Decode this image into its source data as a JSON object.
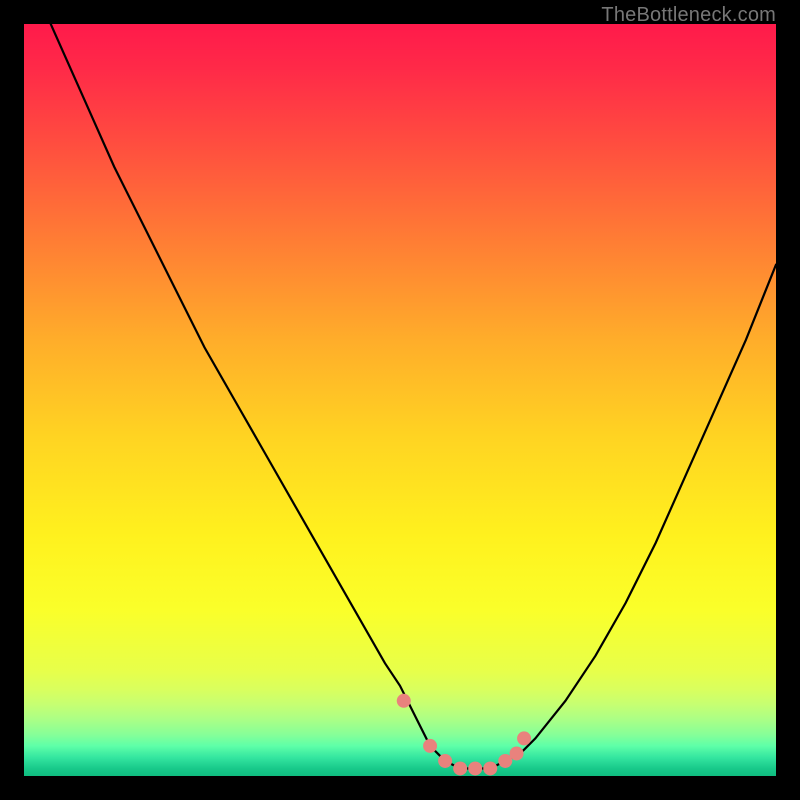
{
  "watermark": "TheBottleneck.com",
  "chart_data": {
    "type": "line",
    "title": "",
    "xlabel": "",
    "ylabel": "",
    "xlim": [
      0,
      100
    ],
    "ylim": [
      0,
      100
    ],
    "series": [
      {
        "name": "curve",
        "x": [
          0,
          4,
          8,
          12,
          16,
          20,
          24,
          28,
          32,
          36,
          40,
          44,
          48,
          50,
          52,
          53,
          54,
          55,
          56,
          58,
          60,
          62,
          64,
          66,
          68,
          72,
          76,
          80,
          84,
          88,
          92,
          96,
          100
        ],
        "y": [
          108,
          99,
          90,
          81,
          73,
          65,
          57,
          50,
          43,
          36,
          29,
          22,
          15,
          12,
          8,
          6,
          4,
          3,
          2,
          1,
          1,
          1,
          2,
          3,
          5,
          10,
          16,
          23,
          31,
          40,
          49,
          58,
          68
        ]
      }
    ],
    "markers": {
      "x": [
        50.5,
        54,
        56,
        58,
        60,
        62,
        64,
        65.5,
        66.5
      ],
      "y": [
        10,
        4,
        2,
        1,
        1,
        1,
        2,
        3,
        5
      ],
      "color": "#e9827d",
      "radius": 7
    },
    "gradient_stops": [
      {
        "offset": 0.0,
        "color": "#ff1a4b"
      },
      {
        "offset": 0.06,
        "color": "#ff2a48"
      },
      {
        "offset": 0.15,
        "color": "#ff4a40"
      },
      {
        "offset": 0.28,
        "color": "#ff7a35"
      },
      {
        "offset": 0.42,
        "color": "#ffad2a"
      },
      {
        "offset": 0.55,
        "color": "#ffd422"
      },
      {
        "offset": 0.68,
        "color": "#fff11e"
      },
      {
        "offset": 0.78,
        "color": "#faff2a"
      },
      {
        "offset": 0.86,
        "color": "#e7ff4a"
      },
      {
        "offset": 0.885,
        "color": "#d9ff5e"
      },
      {
        "offset": 0.905,
        "color": "#c6ff72"
      },
      {
        "offset": 0.925,
        "color": "#aaff86"
      },
      {
        "offset": 0.945,
        "color": "#86ff98"
      },
      {
        "offset": 0.96,
        "color": "#5effa8"
      },
      {
        "offset": 0.975,
        "color": "#35e6a0"
      },
      {
        "offset": 0.99,
        "color": "#18c98a"
      },
      {
        "offset": 1.0,
        "color": "#0fbd80"
      }
    ]
  }
}
